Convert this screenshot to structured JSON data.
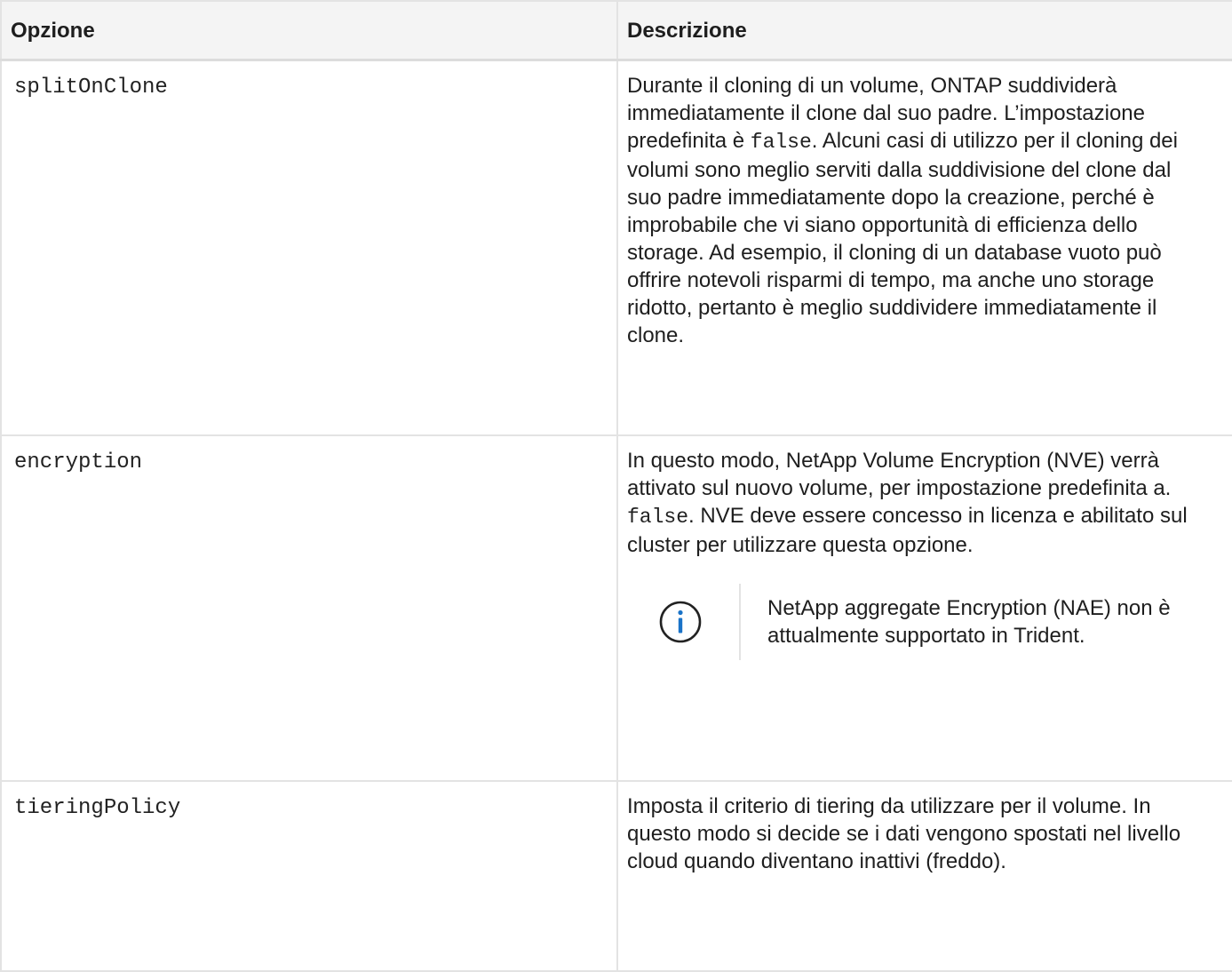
{
  "table": {
    "headers": [
      "Opzione",
      "Descrizione"
    ],
    "rows": [
      {
        "option": "splitOnClone",
        "desc_parts": [
          "Durante il cloning di un volume, ONTAP suddividerà immediatamente il clone dal suo padre. L’impostazione predefinita è ",
          "false",
          ". Alcuni casi di utilizzo per il cloning dei volumi sono meglio serviti dalla suddivisione del clone dal suo padre immediatamente dopo la creazione, perché è improbabile che vi siano opportunità di efficienza dello storage. Ad esempio, il cloning di un database vuoto può offrire notevoli risparmi di tempo, ma anche uno storage ridotto, pertanto è meglio suddividere immediatamente il clone."
        ]
      },
      {
        "option": "encryption",
        "desc_parts": [
          "In questo modo, NetApp Volume Encryption (NVE) verrà attivato sul nuovo volume, per impostazione predefinita a. ",
          "false",
          ". NVE deve essere concesso in licenza e abilitato sul cluster per utilizzare questa opzione."
        ],
        "note": {
          "icon": "info-icon",
          "text": "NetApp aggregate Encryption (NAE) non è attualmente supportato in Trident."
        }
      },
      {
        "option": "tieringPolicy",
        "desc_parts": [
          "Imposta il criterio di tiering da utilizzare per il volume. In questo modo si decide se i dati vengono spostati nel livello cloud quando diventano inattivi (freddo)."
        ]
      }
    ]
  },
  "colors": {
    "header_bg": "#f4f4f4",
    "border": "#e3e3e3",
    "text": "#1e1e1e",
    "info_icon": "#1a73c8"
  }
}
